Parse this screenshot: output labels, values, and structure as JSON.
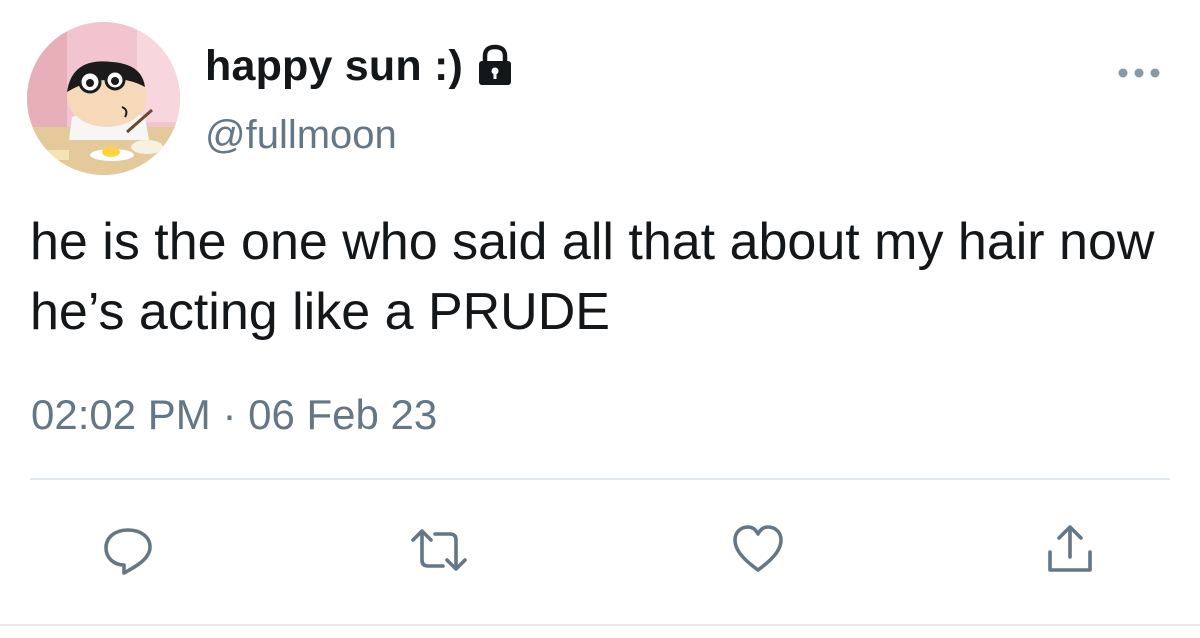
{
  "tweet": {
    "display_name": "happy sun :)",
    "handle": "@fullmoon",
    "text": "he is the one who said all that about my hair now he’s acting like a PRUDE",
    "time": "02:02 PM",
    "separator": "·",
    "date": "06 Feb 23"
  },
  "icons": {
    "verified_lock": "lock-icon",
    "more": "more-icon",
    "reply": "reply-icon",
    "retweet": "retweet-icon",
    "like": "heart-icon",
    "share": "share-icon"
  },
  "colors": {
    "text": "#14171a",
    "secondary": "#657786",
    "icon": "#657786",
    "divider": "#e1e8ed"
  }
}
